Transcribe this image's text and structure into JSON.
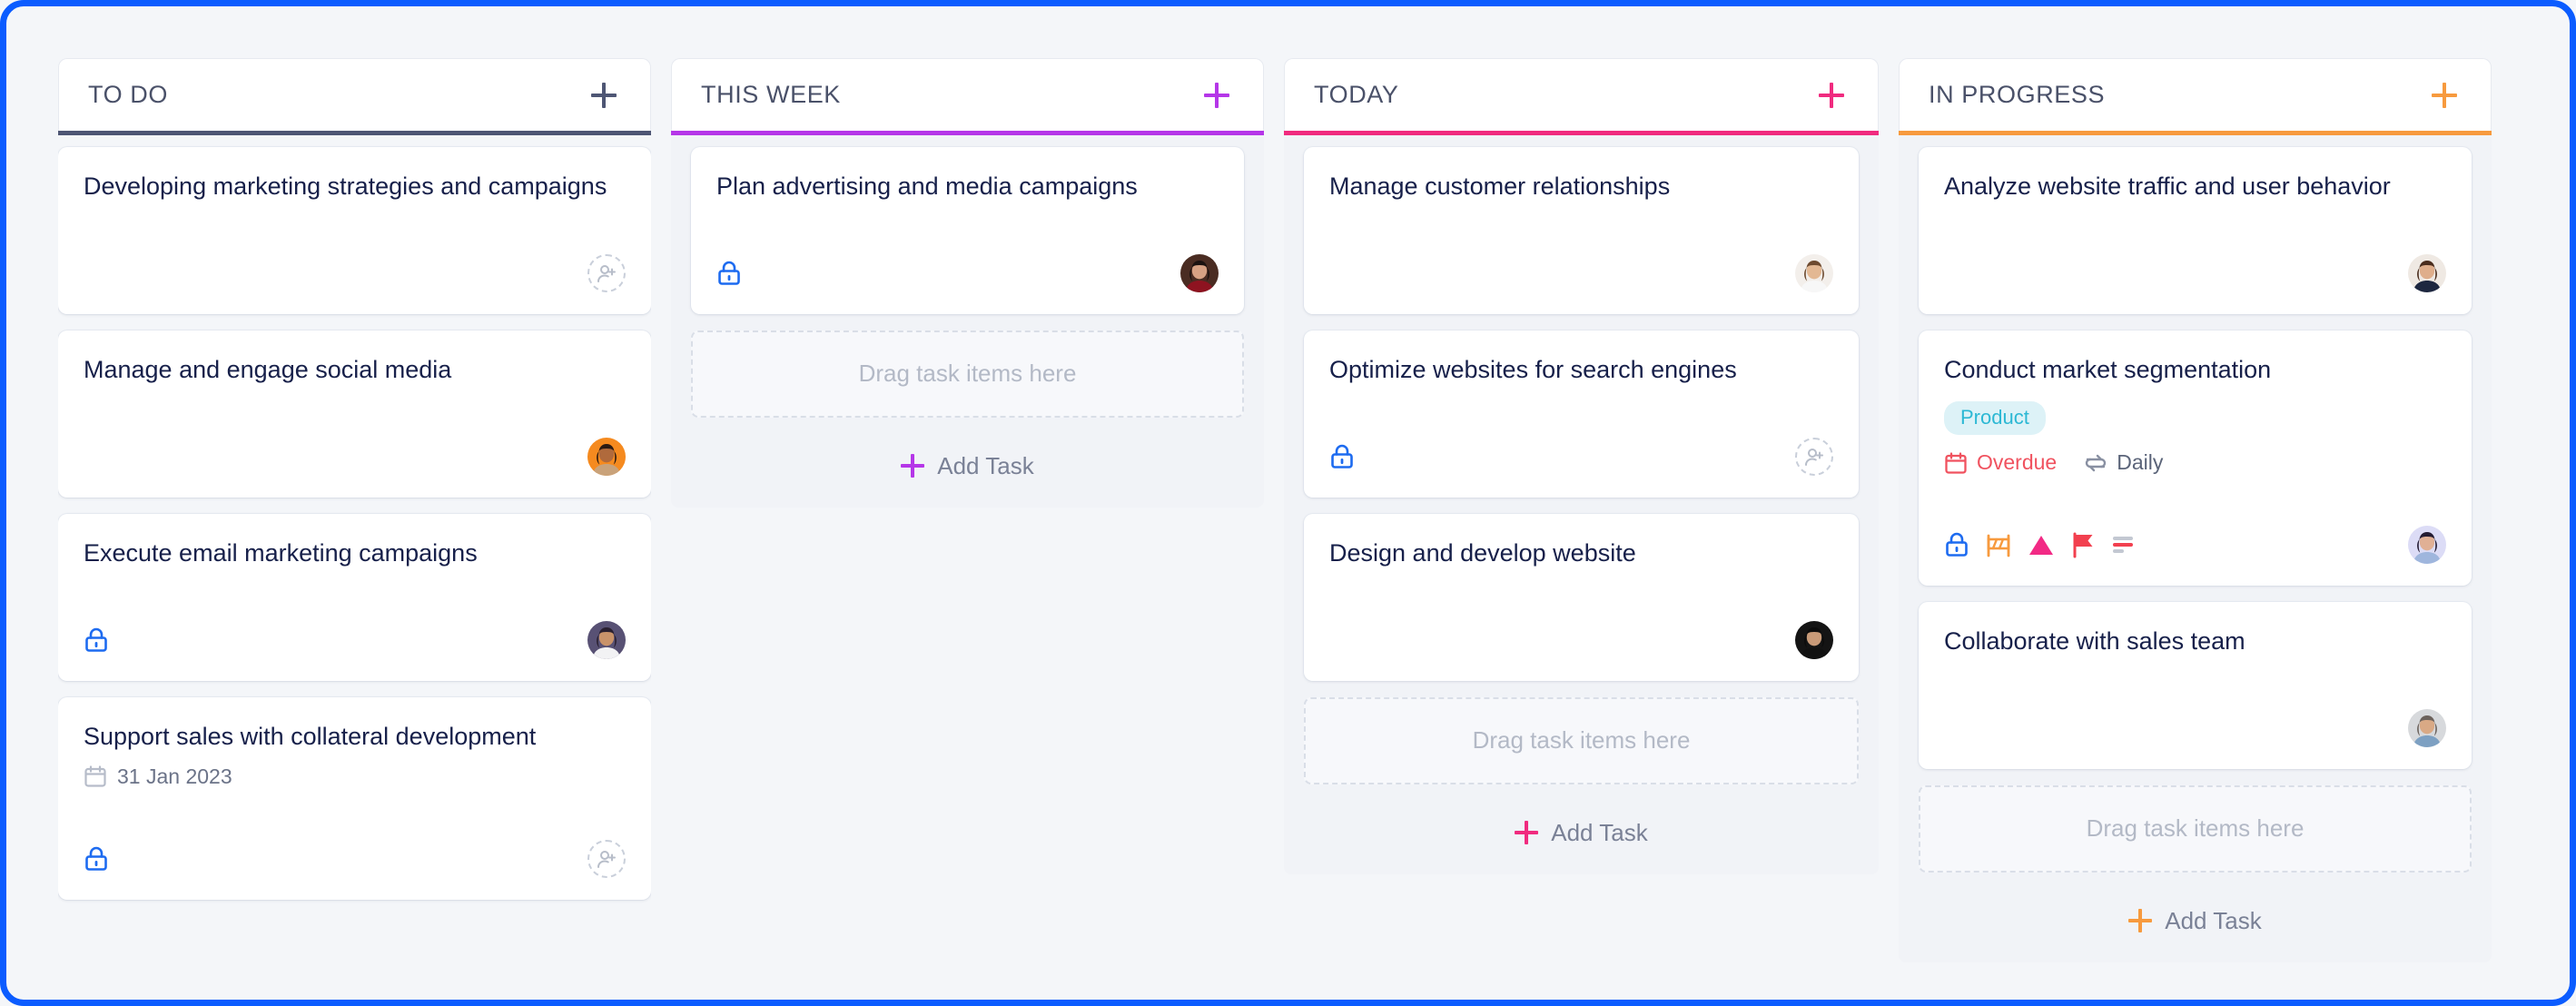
{
  "board": {
    "columns": [
      {
        "id": "todo",
        "title": "TO DO",
        "accent": "#4e5674",
        "add_label": "+",
        "dropzone_text": null,
        "add_task_label": null,
        "cards": [
          {
            "title": "Developing marketing strategies and campaigns",
            "due_date": null,
            "labels": [],
            "status": null,
            "repeat": null,
            "icons": [],
            "assignee": "add-assignee"
          },
          {
            "title": "Manage and engage social media",
            "due_date": null,
            "labels": [],
            "status": null,
            "repeat": null,
            "icons": [],
            "assignee": "avatar-orange-woman"
          },
          {
            "title": "Execute email marketing campaigns",
            "due_date": null,
            "labels": [],
            "status": null,
            "repeat": null,
            "icons": [
              "lock-icon"
            ],
            "assignee": "avatar-purple-man"
          },
          {
            "title": "Support sales with collateral development",
            "due_date": "31 Jan 2023",
            "labels": [],
            "status": null,
            "repeat": null,
            "icons": [
              "lock-icon"
            ],
            "assignee": "add-assignee"
          }
        ]
      },
      {
        "id": "this-week",
        "title": "THIS WEEK",
        "accent": "#b536e8",
        "add_label": "+",
        "dropzone_text": "Drag task items here",
        "add_task_label": "Add Task",
        "cards": [
          {
            "title": "Plan advertising and media campaigns",
            "due_date": null,
            "labels": [],
            "status": null,
            "repeat": null,
            "icons": [
              "lock-icon"
            ],
            "assignee": "avatar-dark-red-woman"
          }
        ]
      },
      {
        "id": "today",
        "title": "TODAY",
        "accent": "#f02b7f",
        "add_label": "+",
        "dropzone_text": "Drag task items here",
        "add_task_label": "Add Task",
        "cards": [
          {
            "title": "Manage customer relationships",
            "due_date": null,
            "labels": [],
            "status": null,
            "repeat": null,
            "icons": [],
            "assignee": "avatar-glasses-man"
          },
          {
            "title": "Optimize websites for search engines",
            "due_date": null,
            "labels": [],
            "status": null,
            "repeat": null,
            "icons": [
              "lock-icon"
            ],
            "assignee": "add-assignee"
          },
          {
            "title": "Design and develop website",
            "due_date": null,
            "labels": [],
            "status": null,
            "repeat": null,
            "icons": [],
            "assignee": "avatar-black-woman"
          }
        ]
      },
      {
        "id": "in-progress",
        "title": "IN PROGRESS",
        "accent": "#f79a3e",
        "add_label": "+",
        "dropzone_text": "Drag task items here",
        "add_task_label": "Add Task",
        "cards": [
          {
            "title": "Analyze website traffic and user behavior",
            "due_date": null,
            "labels": [],
            "status": null,
            "repeat": null,
            "icons": [],
            "assignee": "avatar-brown-hair-woman"
          },
          {
            "title": "Conduct market segmentation",
            "due_date": null,
            "labels": [
              {
                "text": "Product",
                "color": "#2cb8d4",
                "bg": "#ddf2f7"
              }
            ],
            "status": "Overdue",
            "repeat": "Daily",
            "icons": [
              "lock-icon",
              "blocker-icon",
              "priority-triangle-icon",
              "flag-icon",
              "priority-bars-icon"
            ],
            "assignee": "avatar-lavender-woman"
          },
          {
            "title": "Collaborate with sales team",
            "due_date": null,
            "labels": [],
            "status": null,
            "repeat": null,
            "icons": [],
            "assignee": "avatar-gray-man"
          }
        ]
      }
    ]
  },
  "colors": {
    "lock": "#1d6bf0",
    "blocker": "#f79a3e",
    "priority_triangle": "#f22a85",
    "flag": "#f2404f",
    "overdue": "#f0525f",
    "card_title": "#17204a",
    "muted": "#b3b9c6",
    "focus_ring": "#0b5cff"
  }
}
